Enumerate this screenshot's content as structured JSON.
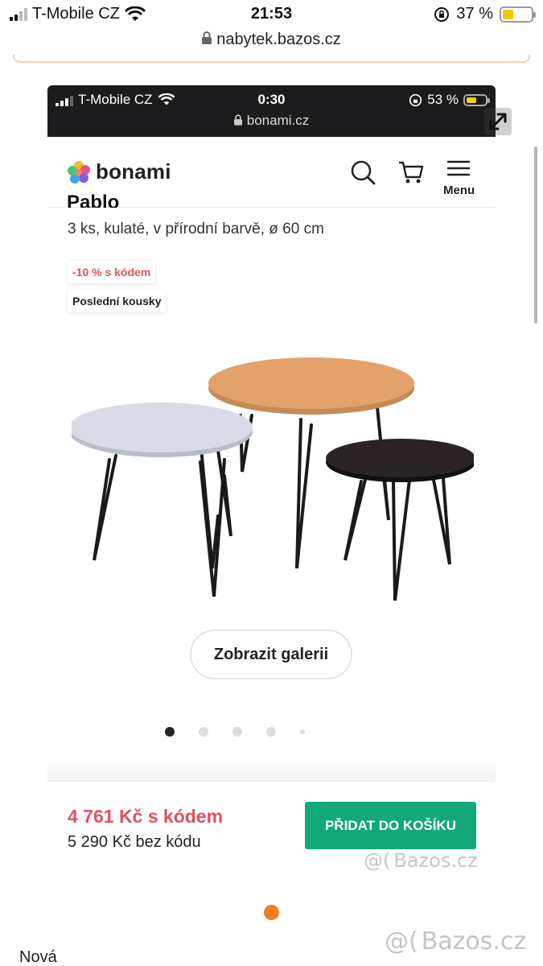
{
  "outer_status": {
    "carrier": "T-Mobile CZ",
    "time": "21:53",
    "battery": "37 %",
    "battery_level": 0.37,
    "battery_color": "#f5c400",
    "url": "nabytek.bazos.cz"
  },
  "inner_status": {
    "carrier": "T-Mobile CZ",
    "time": "0:30",
    "battery": "53 %",
    "battery_level": 0.53,
    "battery_color": "#f5d20a",
    "url": "bonami.cz"
  },
  "site": {
    "logo_text": "bonami",
    "menu_label": "Menu",
    "icons": [
      "search-icon",
      "cart-icon",
      "hamburger-icon"
    ]
  },
  "product": {
    "title": "Pablo",
    "subtitle": "3 ks, kulaté, v přírodní barvě, ø 60 cm",
    "badge_discount": "-10 % s kódem",
    "badge_last": "Poslední kousky",
    "gallery_button": "Zobrazit galerii",
    "gallery_slides": 5,
    "gallery_active": 1,
    "price_with_code": "4 761 Kč s kódem",
    "price_without_code": "5 290 Kč bez kódu",
    "add_to_cart": "PŘIDAT DO KOŠÍKU",
    "table_colors": [
      "#d8dae6",
      "#e3a26a",
      "#2a2426"
    ]
  },
  "colors": {
    "accent_green": "#12a87a",
    "price_red": "#e2505d",
    "orange": "#f47c20"
  },
  "watermark": "Bazos.cz",
  "listing_label": "Nová"
}
